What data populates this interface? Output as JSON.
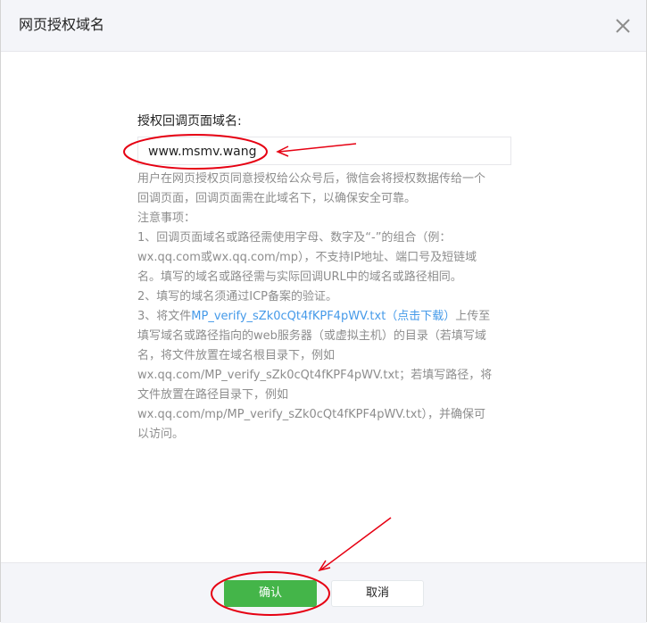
{
  "dialog": {
    "title": "网页授权域名",
    "close_icon": "close-icon"
  },
  "form": {
    "label": "授权回调页面域名:",
    "domain_value": "www.msmv.wang"
  },
  "notes": {
    "intro_1": "用户在网页授权页同意授权给公众号后，微信会将授权数据传给一个",
    "intro_2": "回调页面，回调页面需在此域名下，以确保安全可靠。",
    "heading": "注意事项：",
    "item1_line1": "1、回调页面域名或路径需使用字母、数字及“-”的组合（例：",
    "item1_line2": "wx.qq.com或wx.qq.com/mp），不支持IP地址、端口号及短链域",
    "item1_line3": "名。填写的域名或路径需与实际回调URL中的域名或路径相同。",
    "item2": "2、填写的域名须通过ICP备案的验证。",
    "item3_prefix": "3、将文件",
    "item3_link": "MP_verify_sZk0cQt4fKPF4pWV.txt（点击下载）",
    "item3_suffix": "上传至",
    "item3_line2": "填写域名或路径指向的web服务器（或虚拟主机）的目录（若填写域",
    "item3_line3": "名，将文件放置在域名根目录下，例如",
    "item3_line4": "wx.qq.com/MP_verify_sZk0cQt4fKPF4pWV.txt；若填写路径，将",
    "item3_line5": "文件放置在路径目录下，例如",
    "item3_line6": "wx.qq.com/mp/MP_verify_sZk0cQt4fKPF4pWV.txt），并确保可",
    "item3_line7": "以访问。"
  },
  "footer": {
    "confirm_label": "确认",
    "cancel_label": "取消"
  },
  "colors": {
    "primary": "#44b549",
    "link": "#459ae9",
    "annotation_red": "#e60012"
  }
}
